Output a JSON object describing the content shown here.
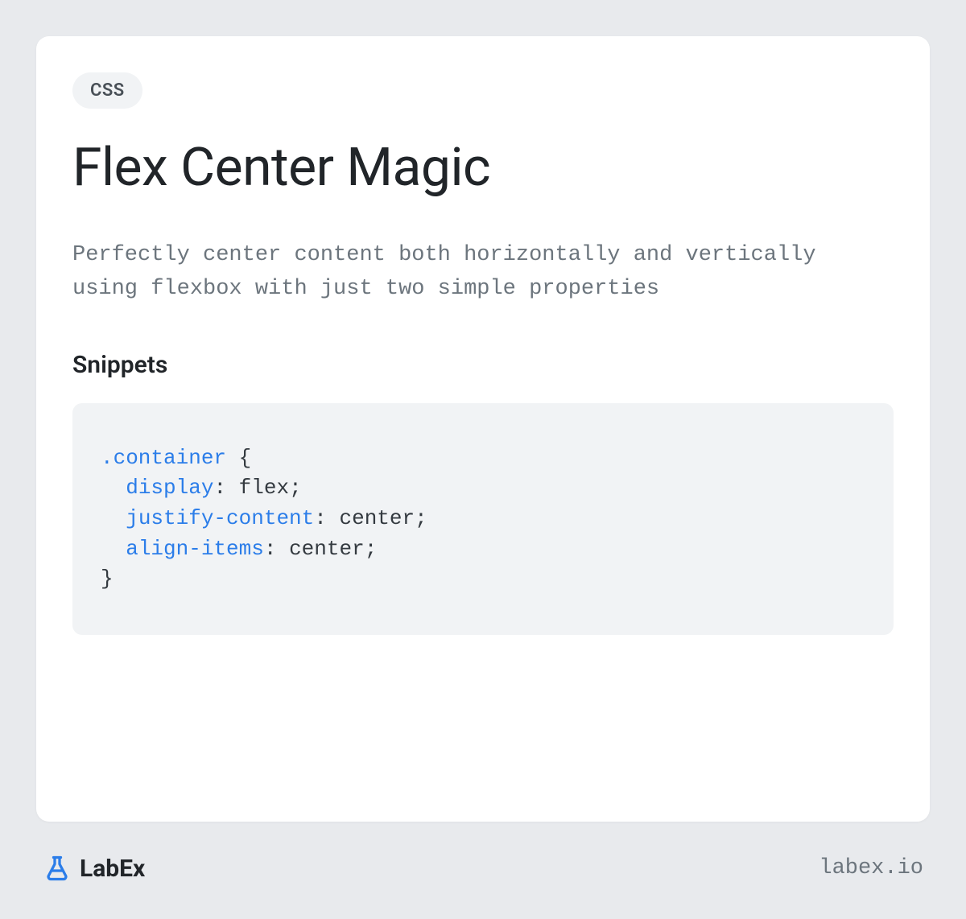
{
  "card": {
    "category": "CSS",
    "title": "Flex Center Magic",
    "description": "Perfectly center content both horizontally and vertically using flexbox with just two simple properties",
    "section_heading": "Snippets",
    "code": {
      "selector": ".container",
      "properties": [
        {
          "key": "display",
          "value": "flex"
        },
        {
          "key": "justify-content",
          "value": "center"
        },
        {
          "key": "align-items",
          "value": "center"
        }
      ]
    }
  },
  "footer": {
    "brand": "LabEx",
    "url": "labex.io"
  }
}
